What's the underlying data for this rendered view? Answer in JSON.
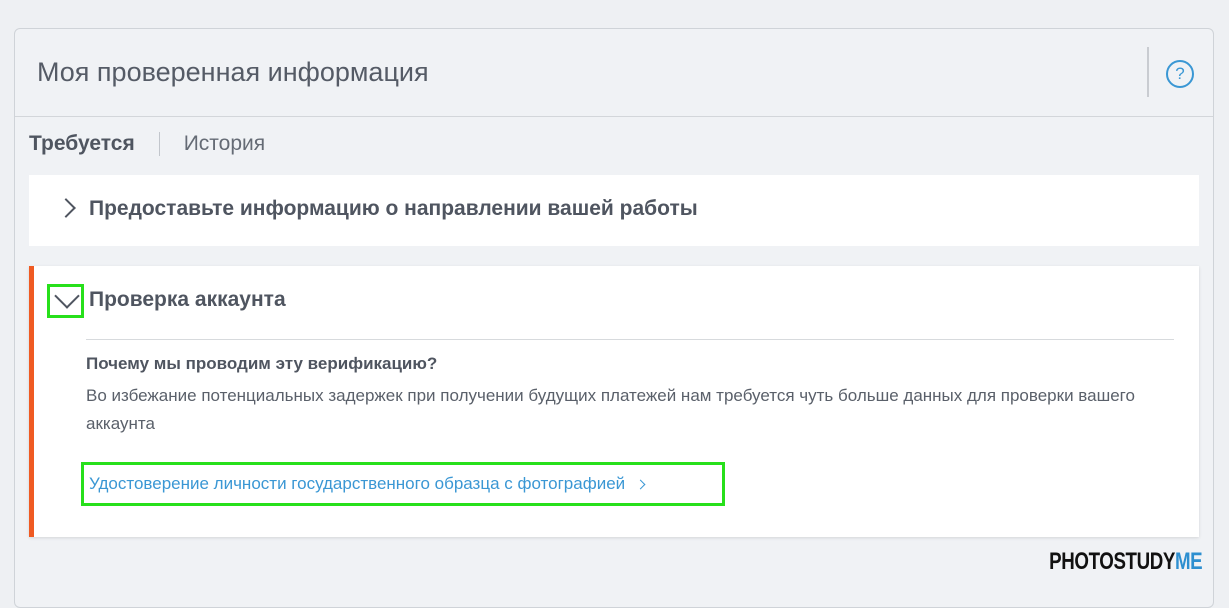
{
  "header": {
    "title": "Моя проверенная информация",
    "help_icon": "?"
  },
  "tabs": [
    {
      "label": "Требуется",
      "active": true
    },
    {
      "label": "История",
      "active": false
    }
  ],
  "cards": {
    "work_direction": {
      "title": "Предоставьте информацию о направлении вашей работы",
      "expanded": false
    },
    "account_verification": {
      "title": "Проверка аккаунта",
      "expanded": true,
      "question": "Почему мы проводим эту верификацию?",
      "explanation": "Во избежание потенциальных задержек при получении будущих платежей нам требуется чуть больше данных для проверки вашего аккаунта",
      "link_label": "Удостоверение личности государственного образца с фотографией"
    }
  },
  "watermark": {
    "part1": "PHOTOSTUDY",
    "part2": "ME"
  },
  "colors": {
    "accent": "#ef5a22",
    "link": "#3a97d4",
    "highlight": "#27e01b"
  }
}
